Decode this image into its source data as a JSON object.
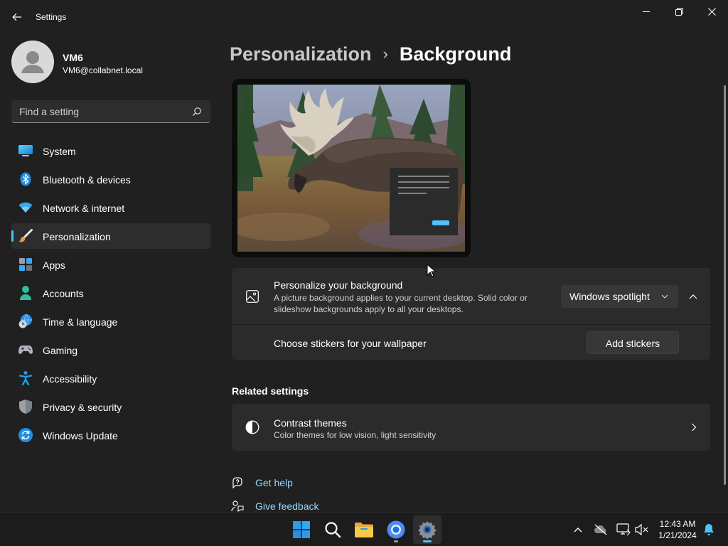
{
  "window": {
    "title": "Settings"
  },
  "user": {
    "name": "VM6",
    "email": "VM6@collabnet.local"
  },
  "search": {
    "placeholder": "Find a setting"
  },
  "sidebar": {
    "items": [
      {
        "label": "System",
        "icon": "system-icon"
      },
      {
        "label": "Bluetooth & devices",
        "icon": "bluetooth-icon"
      },
      {
        "label": "Network & internet",
        "icon": "wifi-icon"
      },
      {
        "label": "Personalization",
        "icon": "brush-icon",
        "active": true
      },
      {
        "label": "Apps",
        "icon": "apps-icon"
      },
      {
        "label": "Accounts",
        "icon": "accounts-icon"
      },
      {
        "label": "Time & language",
        "icon": "globe-clock-icon"
      },
      {
        "label": "Gaming",
        "icon": "gamepad-icon"
      },
      {
        "label": "Accessibility",
        "icon": "accessibility-icon"
      },
      {
        "label": "Privacy & security",
        "icon": "shield-icon"
      },
      {
        "label": "Windows Update",
        "icon": "update-icon"
      }
    ]
  },
  "breadcrumb": {
    "parent": "Personalization",
    "separator": "›",
    "current": "Background"
  },
  "background": {
    "title": "Personalize your background",
    "description_line1": "A picture background applies to your current desktop. Solid color or",
    "description_line2": "slideshow backgrounds apply to all your desktops.",
    "selected": "Windows spotlight",
    "stickers_label": "Choose stickers for your wallpaper",
    "stickers_button": "Add stickers"
  },
  "related": {
    "heading": "Related settings",
    "contrast_title": "Contrast themes",
    "contrast_desc": "Color themes for low vision, light sensitivity"
  },
  "links": {
    "help": "Get help",
    "feedback": "Give feedback"
  },
  "taskbar": {
    "time": "12:43 AM",
    "date": "1/21/2024",
    "apps": [
      "start-icon",
      "search-icon",
      "file-explorer-icon",
      "chrome-icon",
      "settings-icon"
    ]
  },
  "colors": {
    "accent": "#4cc2ff",
    "link": "#99d8ff",
    "background": "#202020",
    "card": "#2b2b2b"
  }
}
